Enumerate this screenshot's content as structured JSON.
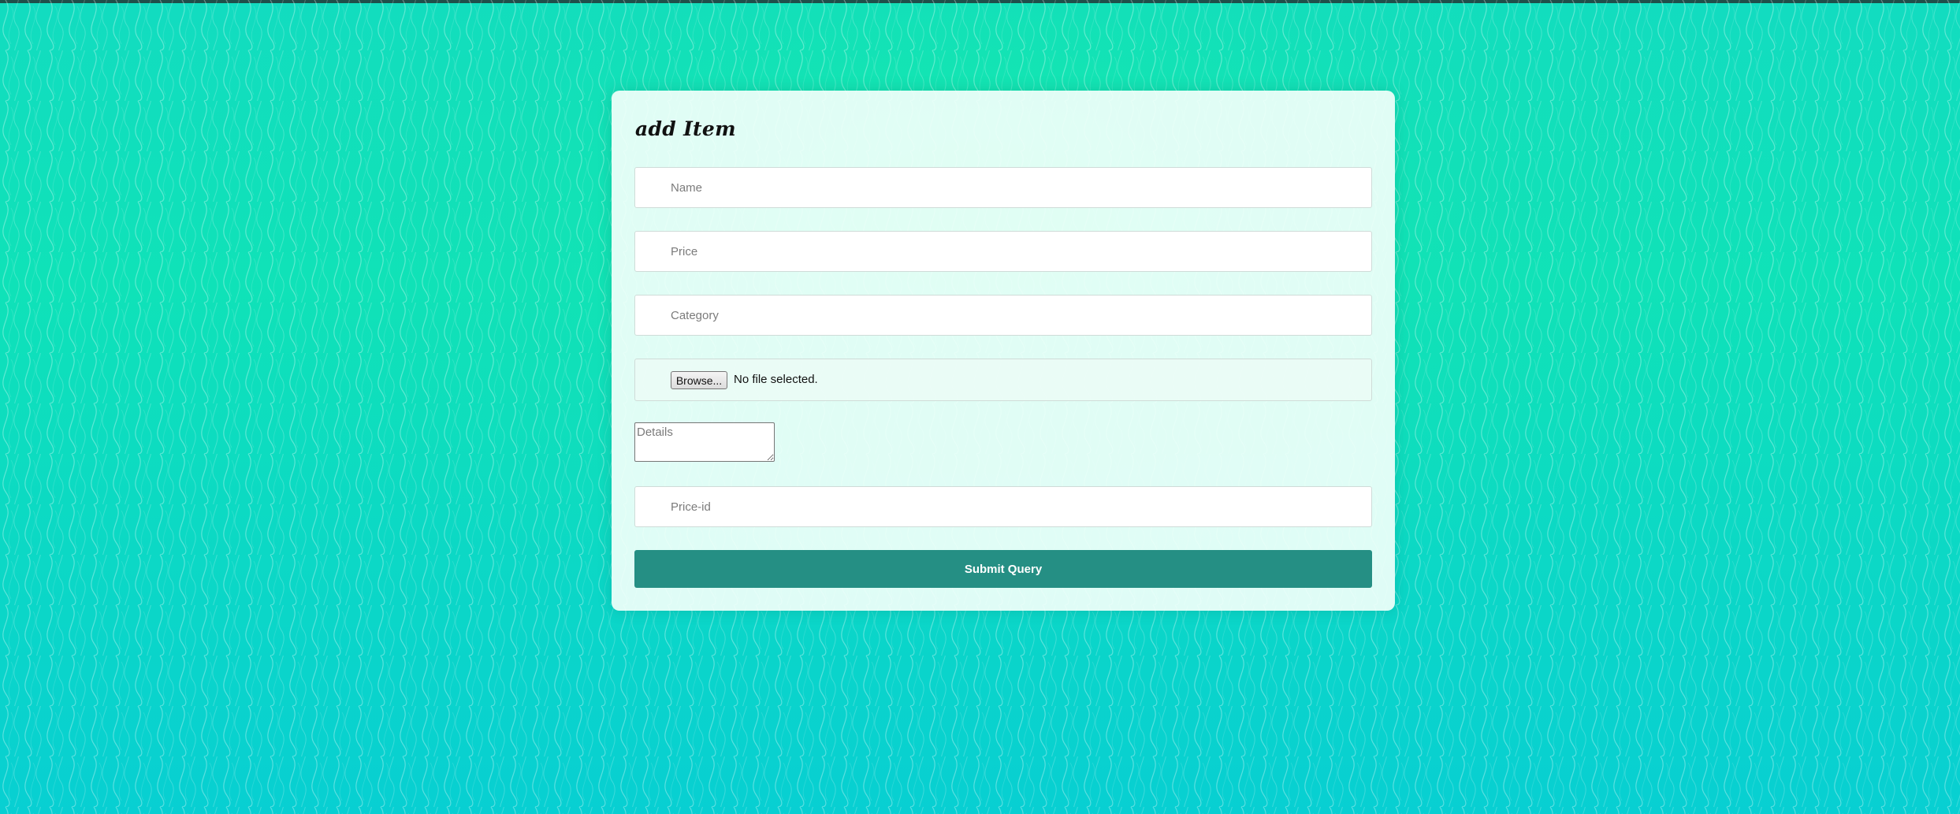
{
  "form": {
    "title": "add Item",
    "name_placeholder": "Name",
    "price_placeholder": "Price",
    "category_placeholder": "Category",
    "file_button_label": "Browse...",
    "file_status": "No file selected.",
    "details_placeholder": "Details",
    "price_id_placeholder": "Price-id",
    "submit_label": "Submit Query"
  },
  "colors": {
    "background_top": "#0fe2b8",
    "background_bottom": "#08cfd2",
    "card_background": "#f0fffa",
    "submit_button": "#258f84",
    "top_bar": "#1f4f4a"
  }
}
